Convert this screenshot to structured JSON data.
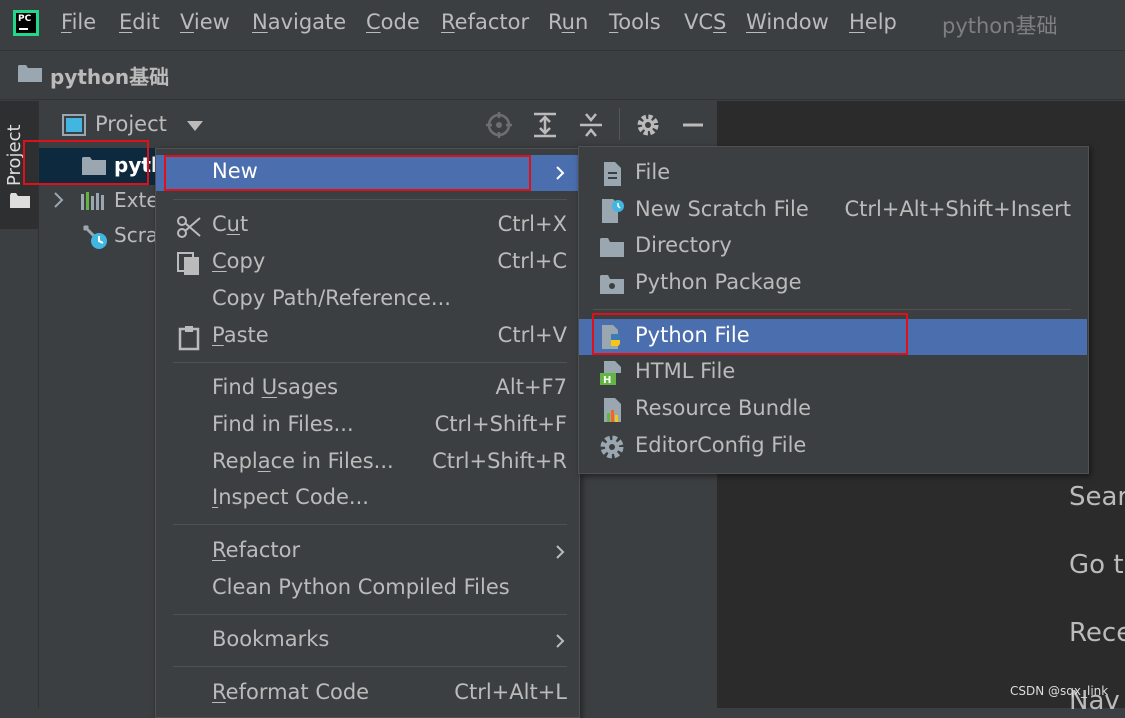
{
  "menubar": {
    "app_logo_text": "PC",
    "items": [
      {
        "label": "File",
        "mnemonic_index": 0
      },
      {
        "label": "Edit",
        "mnemonic_index": 0
      },
      {
        "label": "View",
        "mnemonic_index": 0
      },
      {
        "label": "Navigate",
        "mnemonic_index": 0
      },
      {
        "label": "Code",
        "mnemonic_index": 0
      },
      {
        "label": "Refactor",
        "mnemonic_index": 0
      },
      {
        "label": "Run",
        "mnemonic_index": 1
      },
      {
        "label": "Tools",
        "mnemonic_index": 0
      },
      {
        "label": "VCS",
        "mnemonic_index": 2
      },
      {
        "label": "Window",
        "mnemonic_index": 0
      },
      {
        "label": "Help",
        "mnemonic_index": 0
      }
    ],
    "window_title": "python基础"
  },
  "navbar": {
    "project_name": "python基础"
  },
  "left_stripe": {
    "tab_label": "Project"
  },
  "project_panel": {
    "title": "Project",
    "header_icons": [
      "locate-icon",
      "expand-all-icon",
      "collapse-all-icon",
      "gear-icon",
      "minimize-icon"
    ],
    "tree": {
      "root_label": "pytl",
      "external_label": "Exte",
      "scratches_label": "Scra"
    }
  },
  "context_menu": {
    "new_label": "New",
    "items": {
      "cut": {
        "label": "Cut",
        "shortcut": "Ctrl+X"
      },
      "copy": {
        "label": "Copy",
        "shortcut": "Ctrl+C"
      },
      "copy_path": {
        "label": "Copy Path/Reference..."
      },
      "paste": {
        "label": "Paste",
        "shortcut": "Ctrl+V"
      },
      "find_usages": {
        "label": "Find Usages",
        "shortcut": "Alt+F7"
      },
      "find_in_files": {
        "label": "Find in Files...",
        "shortcut": "Ctrl+Shift+F"
      },
      "replace_in_files": {
        "label": "Replace in Files...",
        "shortcut": "Ctrl+Shift+R"
      },
      "inspect_code": {
        "label": "Inspect Code..."
      },
      "refactor": {
        "label": "Refactor"
      },
      "clean_compiled": {
        "label": "Clean Python Compiled Files"
      },
      "bookmarks": {
        "label": "Bookmarks"
      },
      "reformat_code": {
        "label": "Reformat Code",
        "shortcut": "Ctrl+Alt+L"
      }
    }
  },
  "new_submenu": {
    "items": [
      {
        "label": "File",
        "icon": "file-icon"
      },
      {
        "label": "New Scratch File",
        "shortcut": "Ctrl+Alt+Shift+Insert",
        "icon": "scratch-file-icon"
      },
      {
        "label": "Directory",
        "icon": "directory-icon"
      },
      {
        "label": "Python Package",
        "icon": "python-package-icon"
      },
      {
        "label": "Python File",
        "icon": "python-file-icon",
        "selected": true
      },
      {
        "label": "HTML File",
        "icon": "html-file-icon"
      },
      {
        "label": "Resource Bundle",
        "icon": "resource-bundle-icon"
      },
      {
        "label": "EditorConfig File",
        "icon": "editorconfig-icon"
      }
    ]
  },
  "editor": {
    "hints": [
      "Sear",
      "Go t",
      "Rece",
      "Nav"
    ]
  },
  "watermark": "CSDN @sqx_link",
  "colors": {
    "background": "#3c3f41",
    "editor_background": "#2b2b2b",
    "selection": "#4b6eaf",
    "tree_selection": "#0d293e",
    "annotation_red": "#e0101a"
  }
}
